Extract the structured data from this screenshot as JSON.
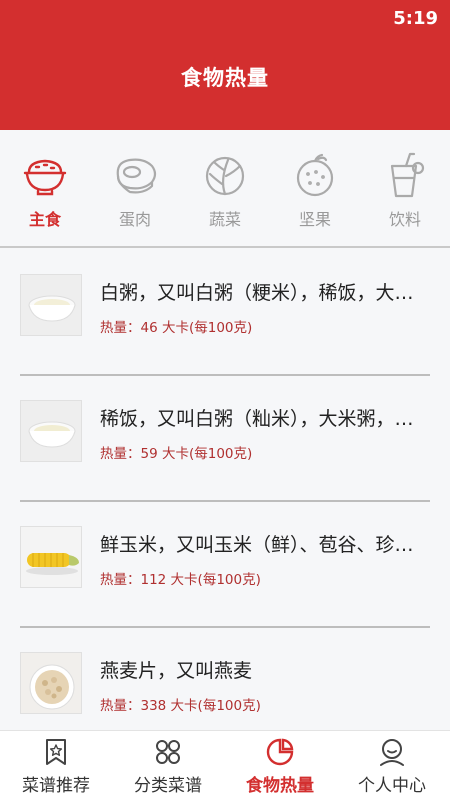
{
  "status": {
    "time": "5:19"
  },
  "header": {
    "title": "食物热量"
  },
  "colors": {
    "brand": "#d32f2f",
    "calorie_text": "#b03030",
    "inactive": "#999999"
  },
  "categories": [
    {
      "label": "主食",
      "icon": "rice-bowl-icon",
      "active": true
    },
    {
      "label": "蛋肉",
      "icon": "meat-icon",
      "active": false
    },
    {
      "label": "蔬菜",
      "icon": "cabbage-icon",
      "active": false
    },
    {
      "label": "坚果",
      "icon": "fruit-icon",
      "active": false
    },
    {
      "label": "饮料",
      "icon": "drink-icon",
      "active": false
    }
  ],
  "foods": [
    {
      "name": "白粥，又叫白粥（粳米），稀饭，大米粥",
      "calorie": "热量：46 大卡(每100克)",
      "image": "porridge-image"
    },
    {
      "name": "稀饭，又叫白粥（籼米），大米粥，白粥",
      "calorie": "热量：59 大卡(每100克)",
      "image": "porridge-image"
    },
    {
      "name": "鲜玉米，又叫玉米（鲜）、苞谷、珍珠米",
      "calorie": "热量：112 大卡(每100克)",
      "image": "corn-image"
    },
    {
      "name": "燕麦片，又叫燕麦",
      "calorie": "热量：338 大卡(每100克)",
      "image": "oatmeal-image"
    }
  ],
  "tabs": [
    {
      "label": "菜谱推荐",
      "icon": "bookmark-icon",
      "active": false
    },
    {
      "label": "分类菜谱",
      "icon": "grid-icon",
      "active": false
    },
    {
      "label": "食物热量",
      "icon": "pie-chart-icon",
      "active": true
    },
    {
      "label": "个人中心",
      "icon": "user-icon",
      "active": false
    }
  ]
}
